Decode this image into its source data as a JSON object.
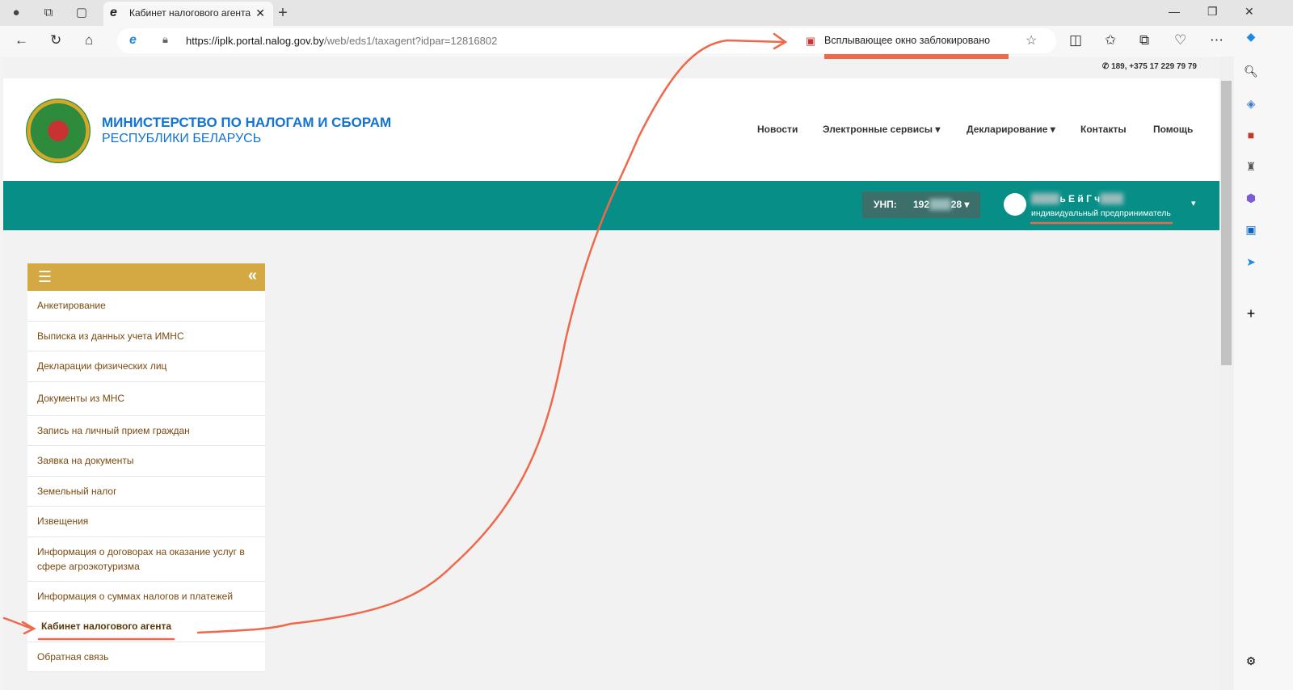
{
  "browser": {
    "tab_title": "Кабинет налогового агента",
    "url_domain": "https://iplk.portal.nalog.gov.by",
    "url_path": "/web/eds1/taxagent?idpar=12816802",
    "popup_blocked": "Всплывающее окно заблокировано"
  },
  "site": {
    "phone": "189, +375 17 229 79 79",
    "title_line1": "МИНИСТЕРСТВО ПО НАЛОГАМ И СБОРАМ",
    "title_line2": "РЕСПУБЛИКИ БЕЛАРУСЬ",
    "menu": [
      "Новости",
      "Электронные сервисы",
      "Декларирование",
      "Контакты",
      "Помощь"
    ],
    "unp_label": "УНП:",
    "unp_prefix": "192",
    "unp_suffix": "28",
    "user_name": "ь Е й Г ч",
    "user_role": "индивидуальный предприниматель"
  },
  "sidebar": {
    "items": [
      "Анкетирование",
      "Выписка из данных учета ИМНС",
      "Декларации физических лиц",
      "Документы из МНС",
      "Запись на личный прием граждан",
      "Заявка на документы",
      "Земельный налог",
      "Извещения",
      "Информация о договорах на оказание услуг в сфере агроэкотуризма",
      "Информация о суммах налогов и платежей",
      "Кабинет налогового агента",
      "Обратная связь"
    ]
  },
  "colors": {
    "teal": "#078f87",
    "gold": "#d4a843",
    "annotation": "#f0684a"
  }
}
